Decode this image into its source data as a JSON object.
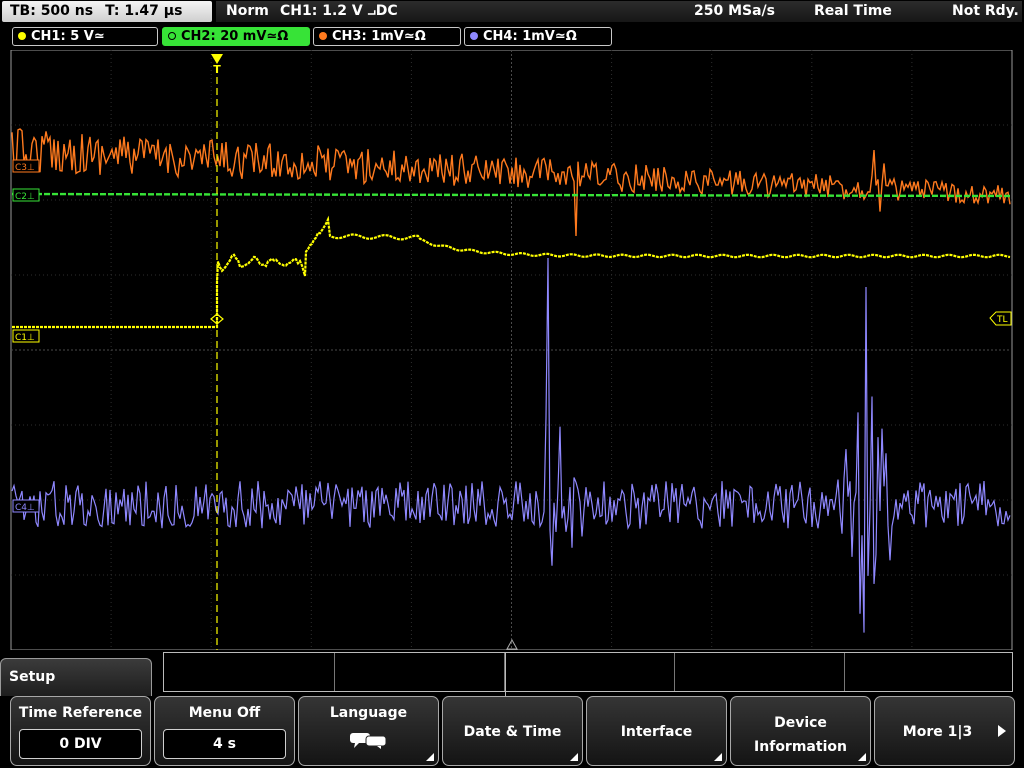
{
  "status": {
    "timebase": "TB: 500 ns",
    "trigger_time": "T: 1.47 µs",
    "mode": "Norm",
    "trigger_info": "CH1: 1.2 V ⨼DC",
    "sample_rate": "250 MSa/s",
    "acq_mode": "Real Time",
    "state": "Not Rdy."
  },
  "channels": [
    {
      "label": "CH1: 5 V≃",
      "color": "#ffff00"
    },
    {
      "label": "CH2: 20 mV≃Ω",
      "color": "#37e337"
    },
    {
      "label": "CH3: 1mV≃Ω",
      "color": "#ff7a1e"
    },
    {
      "label": "CH4: 1mV≃Ω",
      "color": "#8f88ff"
    }
  ],
  "markers": {
    "ch1": "C1⊥",
    "trigger_level": "TL",
    "ch3": "C3⊥",
    "ch2": "C2⊥",
    "ch4": "C4⊥",
    "trigger_point": "T"
  },
  "menu": {
    "title": "Setup",
    "softkeys": [
      {
        "label": "Time Reference",
        "value": "0 DIV"
      },
      {
        "label": "Menu Off",
        "value": "4 s"
      },
      {
        "label": "Language",
        "icon": "speech-bubbles-icon"
      },
      {
        "label": "Date & Time"
      },
      {
        "label": "Interface"
      },
      {
        "label": "Device",
        "label2": "Information"
      },
      {
        "label": "More 1|3"
      }
    ]
  }
}
